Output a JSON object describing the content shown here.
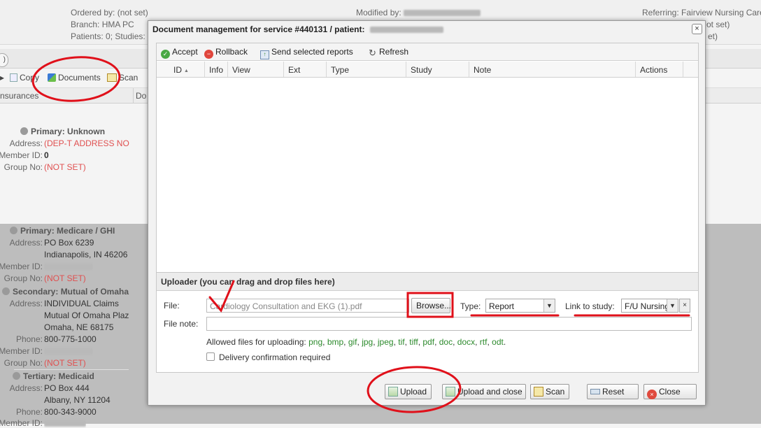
{
  "background": {
    "header": {
      "ordered_by": "Ordered by: (not set)",
      "branch": "Branch: HMA PC",
      "patients_studies": "Patients: 0; Studies:",
      "modified_by": "Modified by:",
      "referring": "Referring: Fairview Nursing Care",
      "not_set_1": "ot set)",
      "not_set_2": "et)"
    },
    "toolbar": {
      "copy": "Copy",
      "documents": "Documents",
      "scan": "Scan"
    },
    "columns": {
      "insurances": "nsurances",
      "do": "Do"
    },
    "insurances": [
      {
        "title": "Primary: Unknown",
        "address_label": "Address:",
        "address": "(DEP-T ADDRESS NO",
        "member_label": "Member ID:",
        "member_id": "0",
        "group_label": "Group No:",
        "group_no": "(NOT SET)"
      },
      {
        "title": "Primary: Medicare / GHI",
        "address_label": "Address:",
        "address_1": "PO Box 6239",
        "address_2": "Indianapolis, IN 46206",
        "member_label": "Member ID:",
        "group_label": "Group No:",
        "group_no": "(NOT SET)"
      },
      {
        "title": "Secondary: Mutual of Omaha",
        "address_label": "Address:",
        "address_1": "INDIVIDUAL Claims",
        "address_2": "Mutual Of Omaha Plaz",
        "address_3": "Omaha, NE 68175",
        "phone_label": "Phone:",
        "phone": "800-775-1000",
        "member_label": "Member ID:",
        "group_label": "Group No:",
        "group_no": "(NOT SET)"
      },
      {
        "title": "Tertiary: Medicaid",
        "address_label": "Address:",
        "address_1": "PO Box 444",
        "address_2": "Albany, NY 11204",
        "phone_label": "Phone:",
        "phone": "800-343-9000",
        "member_label": "Member ID:"
      }
    ]
  },
  "dialog": {
    "title": "Document management for service #440131 / patient:",
    "close_glyph": "×",
    "toolbar": {
      "accept": "Accept",
      "rollback": "Rollback",
      "send_selected_reports": "Send selected reports",
      "refresh": "Refresh"
    },
    "columns": [
      "ID",
      "Info",
      "View",
      "Ext",
      "Type",
      "Study",
      "Note",
      "Actions"
    ],
    "uploader": {
      "heading": "Uploader (you can drag and drop files here)",
      "file_label": "File:",
      "file_value": "Cardiology Consultation and EKG (1).pdf",
      "browse": "Browse...",
      "type_label": "Type:",
      "type_value": "Report",
      "link_label": "Link to study:",
      "link_value": "F/U Nursing",
      "clear_glyph": "×",
      "file_note_label": "File note:",
      "file_note_value": "",
      "allowed_label": "Allowed files for uploading:",
      "allowed_exts": [
        "png",
        "bmp",
        "gif",
        "jpg",
        "jpeg",
        "tif",
        "tiff",
        "pdf",
        "doc",
        "docx",
        "rtf",
        "odt"
      ],
      "delivery_confirmation": "Delivery confirmation required"
    },
    "footer": {
      "upload": "Upload",
      "upload_and_close": "Upload and close",
      "scan": "Scan",
      "reset": "Reset",
      "close": "Close"
    }
  },
  "colors": {
    "annotation": "#e0101a",
    "link_green": "#2d8a2d",
    "warning_red": "#e05050"
  }
}
